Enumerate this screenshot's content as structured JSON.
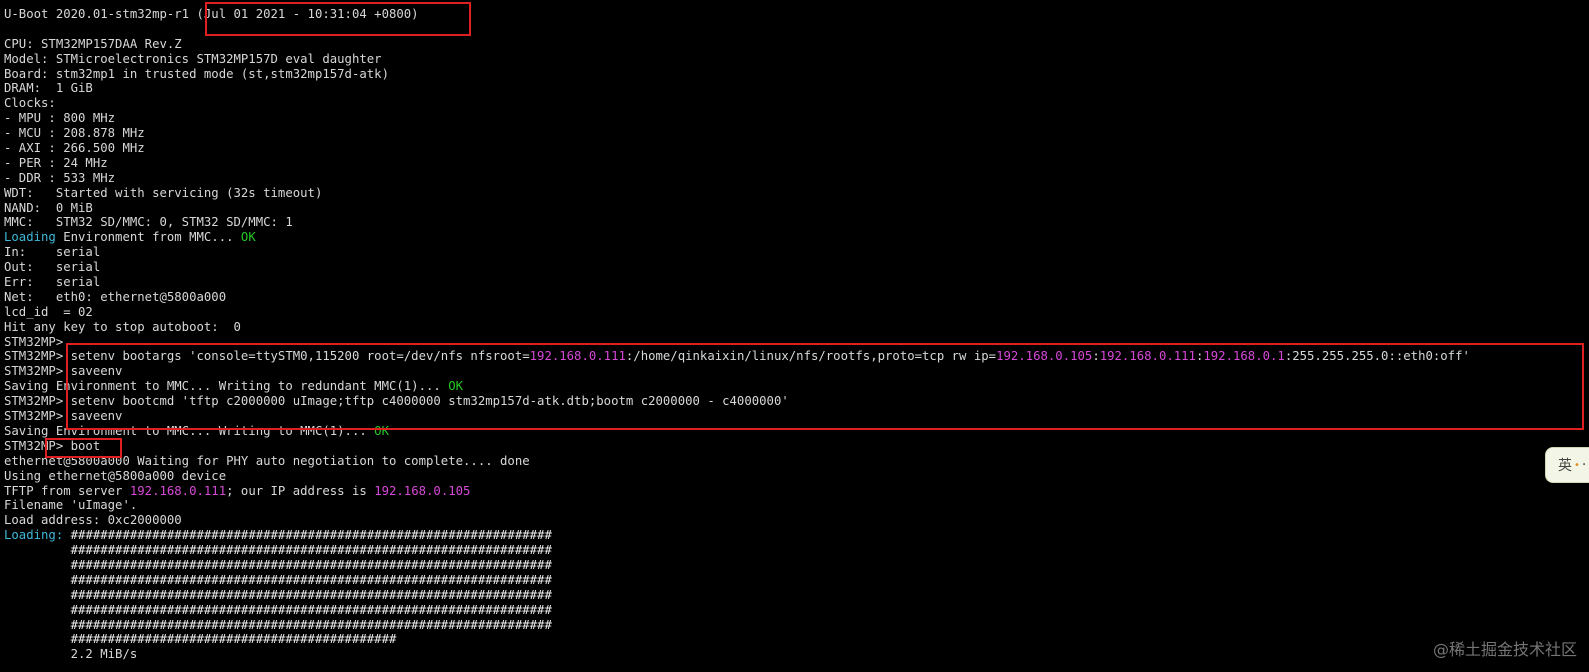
{
  "terminal": {
    "lines": [
      [
        {
          "t": "U-Boot 2020.01-stm32mp-r1 (Jul 01 2021 - 10:31:04 +0800)"
        }
      ],
      [
        {
          "t": ""
        }
      ],
      [
        {
          "t": "CPU: STM32MP157DAA Rev.Z"
        }
      ],
      [
        {
          "t": "Model: STMicroelectronics STM32MP157D eval daughter"
        }
      ],
      [
        {
          "t": "Board: stm32mp1 in trusted mode (st,stm32mp157d-atk)"
        }
      ],
      [
        {
          "t": "DRAM:  1 GiB"
        }
      ],
      [
        {
          "t": "Clocks:"
        }
      ],
      [
        {
          "t": "- MPU : 800 MHz"
        }
      ],
      [
        {
          "t": "- MCU : 208.878 MHz"
        }
      ],
      [
        {
          "t": "- AXI : 266.500 MHz"
        }
      ],
      [
        {
          "t": "- PER : 24 MHz"
        }
      ],
      [
        {
          "t": "- DDR : 533 MHz"
        }
      ],
      [
        {
          "t": "WDT:   Started with servicing (32s timeout)"
        }
      ],
      [
        {
          "t": "NAND:  0 MiB"
        }
      ],
      [
        {
          "t": "MMC:   STM32 SD/MMC: 0, STM32 SD/MMC: 1"
        }
      ],
      [
        {
          "t": "Loading",
          "c": "cyan"
        },
        {
          "t": " Environment from MMC... "
        },
        {
          "t": "OK",
          "c": "green"
        }
      ],
      [
        {
          "t": "In:    serial"
        }
      ],
      [
        {
          "t": "Out:   serial"
        }
      ],
      [
        {
          "t": "Err:   serial"
        }
      ],
      [
        {
          "t": "Net:   eth0: ethernet@5800a000"
        }
      ],
      [
        {
          "t": "lcd_id  = 02"
        }
      ],
      [
        {
          "t": "Hit any key to stop autoboot:  0"
        }
      ],
      [
        {
          "t": "STM32MP>"
        }
      ],
      [
        {
          "t": "STM32MP> setenv bootargs 'console=ttySTM0,115200 root=/dev/nfs nfsroot="
        },
        {
          "t": "192.168.0.111",
          "c": "magenta"
        },
        {
          "t": ":/home/qinkaixin/linux/nfs/rootfs,proto=tcp rw ip="
        },
        {
          "t": "192.168.0.105",
          "c": "magenta"
        },
        {
          "t": ":"
        },
        {
          "t": "192.168.0.111",
          "c": "magenta"
        },
        {
          "t": ":"
        },
        {
          "t": "192.168.0.1",
          "c": "magenta"
        },
        {
          "t": ":255.255.255.0::eth0:off'"
        }
      ],
      [
        {
          "t": "STM32MP> saveenv"
        }
      ],
      [
        {
          "t": "Saving Environment to MMC... Writing to redundant MMC(1)... "
        },
        {
          "t": "OK",
          "c": "green"
        }
      ],
      [
        {
          "t": "STM32MP> setenv bootcmd 'tftp c2000000 uImage;tftp c4000000 stm32mp157d-atk.dtb;bootm c2000000 - c4000000'"
        }
      ],
      [
        {
          "t": "STM32MP> saveenv"
        }
      ],
      [
        {
          "t": "Saving Environment to MMC... Writing to MMC(1)... "
        },
        {
          "t": "OK",
          "c": "green"
        }
      ],
      [
        {
          "t": "STM32MP> boot"
        }
      ],
      [
        {
          "t": "ethernet@5800a000 Waiting for PHY auto negotiation to complete.... done"
        }
      ],
      [
        {
          "t": "Using ethernet@5800a000 device"
        }
      ],
      [
        {
          "t": "TFTP from server "
        },
        {
          "t": "192.168.0.111",
          "c": "magenta"
        },
        {
          "t": "; our IP address is "
        },
        {
          "t": "192.168.0.105",
          "c": "magenta"
        }
      ],
      [
        {
          "t": "Filename 'uImage'."
        }
      ],
      [
        {
          "t": "Load address: 0xc2000000"
        }
      ],
      [
        {
          "t": "Loading:",
          "c": "cyan"
        },
        {
          "t": " #################################################################",
          "c": "white"
        }
      ],
      [
        {
          "t": "         #################################################################",
          "c": "white"
        }
      ],
      [
        {
          "t": "         #################################################################",
          "c": "white"
        }
      ],
      [
        {
          "t": "         #################################################################",
          "c": "white"
        }
      ],
      [
        {
          "t": "         #################################################################",
          "c": "white"
        }
      ],
      [
        {
          "t": "         #################################################################",
          "c": "white"
        }
      ],
      [
        {
          "t": "         #################################################################",
          "c": "white"
        }
      ],
      [
        {
          "t": "         ############################################",
          "c": "white"
        }
      ],
      [
        {
          "t": "         2.2 MiB/s"
        }
      ]
    ]
  },
  "ime": {
    "label": "英",
    "dot": "•",
    "extra": "·"
  },
  "watermark": {
    "text": "@稀土掘金技术社区"
  },
  "colors": {
    "background": "#000000",
    "text": "#d8d8d8",
    "cyan": "#3fb8d8",
    "green": "#23c923",
    "magenta": "#d648d6",
    "highlight": "#e02020"
  }
}
